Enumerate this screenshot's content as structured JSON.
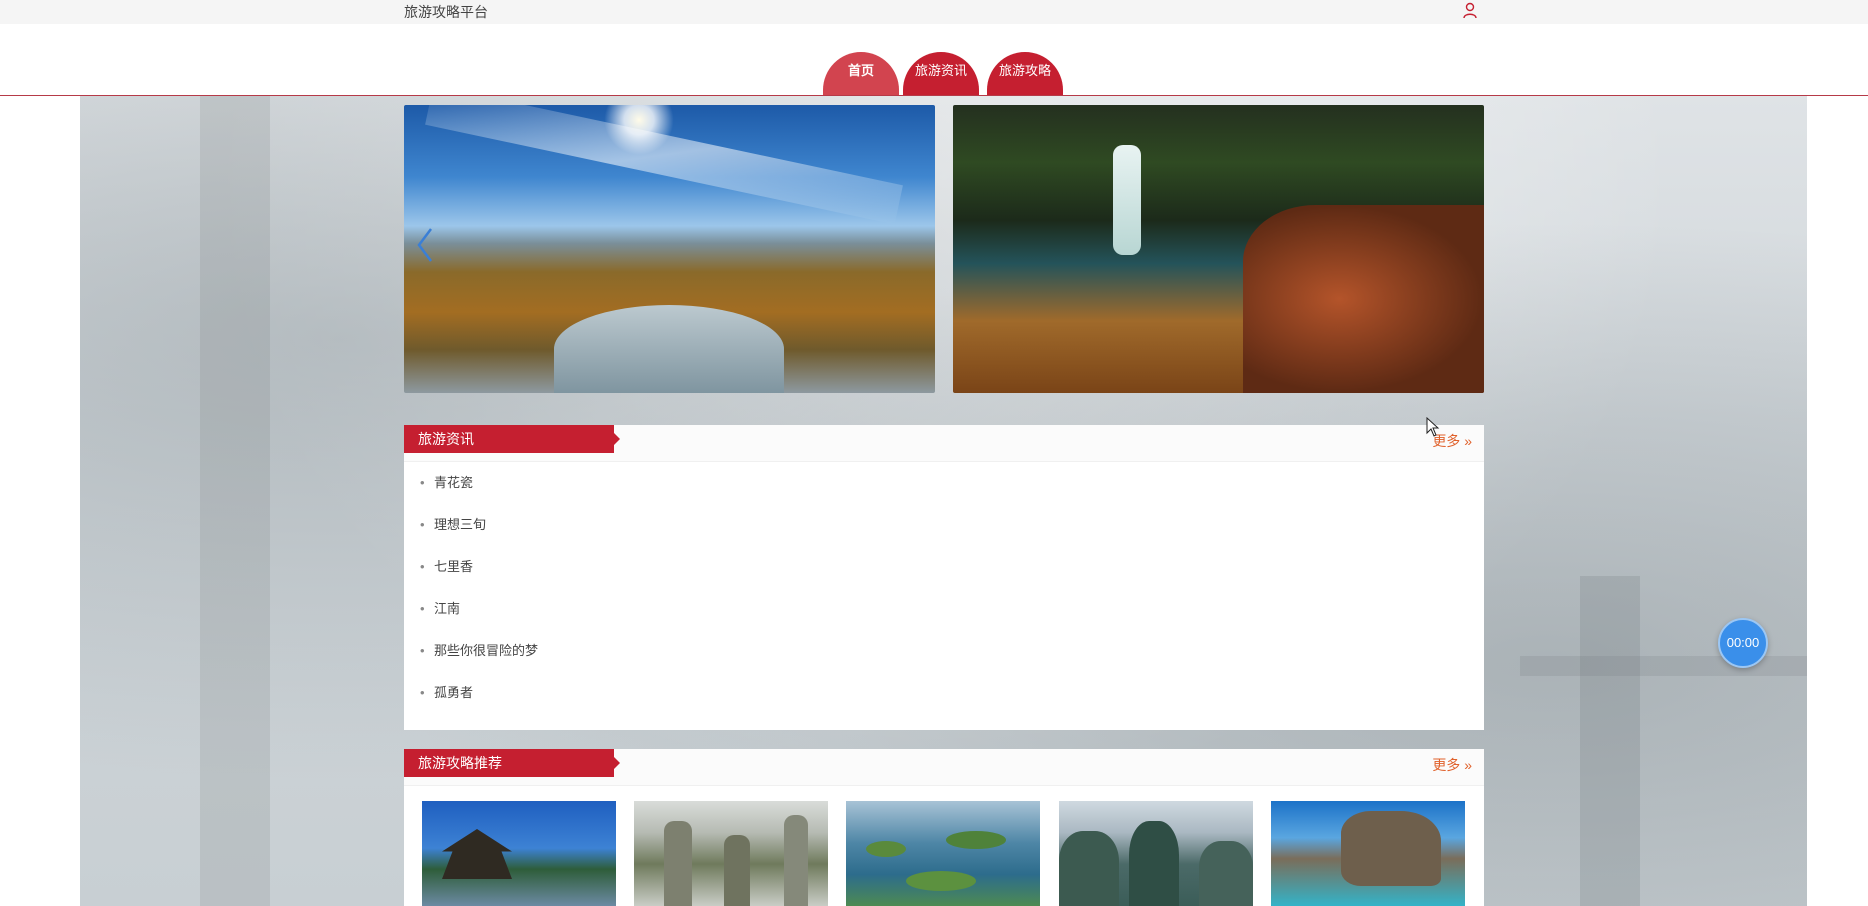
{
  "header": {
    "site_title": "旅游攻略平台",
    "user_icon": "user-icon"
  },
  "nav": {
    "tabs": [
      {
        "label": "首页",
        "active": true
      },
      {
        "label": "旅游资讯",
        "active": false
      },
      {
        "label": "旅游攻略",
        "active": false
      }
    ]
  },
  "news": {
    "title": "旅游资讯",
    "more": "更多",
    "items": [
      "青花瓷",
      "理想三旬",
      "七里香",
      "江南",
      "那些你很冒险的梦",
      "孤勇者"
    ]
  },
  "guides": {
    "title": "旅游攻略推荐",
    "more": "更多"
  },
  "timer": {
    "value": "00:00"
  },
  "colors": {
    "accent": "#c51f30",
    "more_link": "#e0612b",
    "timer": "#3a8fea"
  }
}
